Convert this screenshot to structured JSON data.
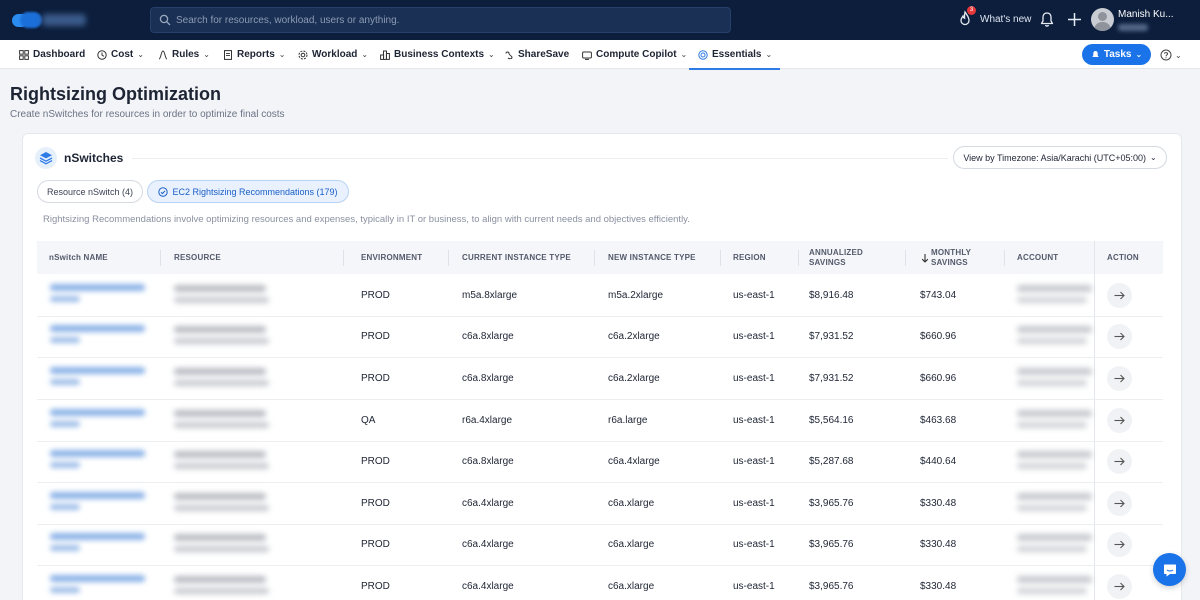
{
  "topbar": {
    "search_placeholder": "Search for resources, workload, users or anything.",
    "notifications_badge": "3",
    "whats_new": "What's new",
    "user_name": "Manish Ku..."
  },
  "nav": {
    "dashboard": "Dashboard",
    "cost": "Cost",
    "rules": "Rules",
    "reports": "Reports",
    "workload": "Workload",
    "business_contexts": "Business Contexts",
    "sharesave": "ShareSave",
    "compute_copilot": "Compute Copilot",
    "essentials": "Essentials",
    "active": "Essentials",
    "tasks": "Tasks"
  },
  "page": {
    "title": "Rightsizing Optimization",
    "subtitle": "Create nSwitches for resources in order to optimize final costs"
  },
  "card": {
    "title": "nSwitches",
    "timezone": "View by Timezone: Asia/Karachi (UTC+05:00)",
    "tab_resource": "Resource nSwitch (4)",
    "tab_ec2": "EC2 Rightsizing Recommendations (179)",
    "tab_active": "EC2 Rightsizing Recommendations (179)",
    "description": "Rightsizing Recommendations involve optimizing resources and expenses, typically in IT or business, to align with current needs and objectives efficiently."
  },
  "table": {
    "columns": {
      "name": "nSwitch NAME",
      "resource": "RESOURCE",
      "environment": "ENVIRONMENT",
      "current": "CURRENT INSTANCE TYPE",
      "new": "NEW INSTANCE TYPE",
      "region": "REGION",
      "annualized": "ANNUALIZED SAVINGS",
      "monthly": "MONTHLY SAVINGS",
      "account": "ACCOUNT",
      "action": "ACTION"
    },
    "sorted_by": "MONTHLY SAVINGS",
    "rows": [
      {
        "env": "PROD",
        "current": "m5a.8xlarge",
        "new": "m5a.2xlarge",
        "region": "us-east-1",
        "annual": "$8,916.48",
        "monthly": "$743.04"
      },
      {
        "env": "PROD",
        "current": "c6a.8xlarge",
        "new": "c6a.2xlarge",
        "region": "us-east-1",
        "annual": "$7,931.52",
        "monthly": "$660.96"
      },
      {
        "env": "PROD",
        "current": "c6a.8xlarge",
        "new": "c6a.2xlarge",
        "region": "us-east-1",
        "annual": "$7,931.52",
        "monthly": "$660.96"
      },
      {
        "env": "QA",
        "current": "r6a.4xlarge",
        "new": "r6a.large",
        "region": "us-east-1",
        "annual": "$5,564.16",
        "monthly": "$463.68"
      },
      {
        "env": "PROD",
        "current": "c6a.8xlarge",
        "new": "c6a.4xlarge",
        "region": "us-east-1",
        "annual": "$5,287.68",
        "monthly": "$440.64"
      },
      {
        "env": "PROD",
        "current": "c6a.4xlarge",
        "new": "c6a.xlarge",
        "region": "us-east-1",
        "annual": "$3,965.76",
        "monthly": "$330.48"
      },
      {
        "env": "PROD",
        "current": "c6a.4xlarge",
        "new": "c6a.xlarge",
        "region": "us-east-1",
        "annual": "$3,965.76",
        "monthly": "$330.48"
      },
      {
        "env": "PROD",
        "current": "c6a.4xlarge",
        "new": "c6a.xlarge",
        "region": "us-east-1",
        "annual": "$3,965.76",
        "monthly": "$330.48"
      }
    ]
  },
  "colors": {
    "topbar_bg": "#0c1e3c",
    "accent": "#1a73e8",
    "page_bg": "#f3f4f7"
  },
  "icons": [
    "search-icon",
    "flame-icon",
    "bell-icon",
    "plus-icon",
    "avatar",
    "dashboard-icon",
    "cost-icon",
    "rules-icon",
    "reports-icon",
    "workload-icon",
    "business-contexts-icon",
    "sharesave-icon",
    "compute-copilot-icon",
    "essentials-icon",
    "help-icon",
    "layers-icon",
    "check-circle-icon",
    "sort-down-icon",
    "arrow-right-icon",
    "chat-icon"
  ]
}
